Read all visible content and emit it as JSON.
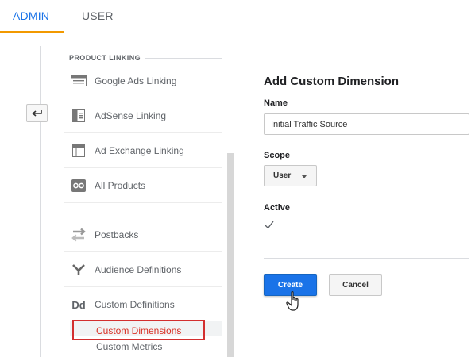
{
  "tabs": {
    "admin": "ADMIN",
    "user": "USER"
  },
  "nav": {
    "section_title": "PRODUCT LINKING",
    "items": [
      {
        "label": "Google Ads Linking",
        "icon": "google-ads-icon"
      },
      {
        "label": "AdSense Linking",
        "icon": "adsense-icon"
      },
      {
        "label": "Ad Exchange Linking",
        "icon": "ad-exchange-icon"
      },
      {
        "label": "All Products",
        "icon": "all-products-icon"
      },
      {
        "label": "Postbacks",
        "icon": "postbacks-icon"
      },
      {
        "label": "Audience Definitions",
        "icon": "audience-icon"
      },
      {
        "label": "Custom Definitions",
        "icon": "custom-definitions-icon",
        "glyph": "Dd"
      }
    ],
    "sub_items": [
      {
        "label": "Custom Dimensions",
        "active": true
      },
      {
        "label": "Custom Metrics",
        "active": false
      }
    ]
  },
  "form": {
    "title": "Add Custom Dimension",
    "name_label": "Name",
    "name_value": "Initial Traffic Source",
    "scope_label": "Scope",
    "scope_value": "User",
    "active_label": "Active",
    "active_checked": true,
    "create_label": "Create",
    "cancel_label": "Cancel"
  },
  "colors": {
    "accent": "#1a73e8",
    "tab_underline": "#f29900",
    "active_sub": "#d93025",
    "highlight_box": "#d32f2f"
  }
}
